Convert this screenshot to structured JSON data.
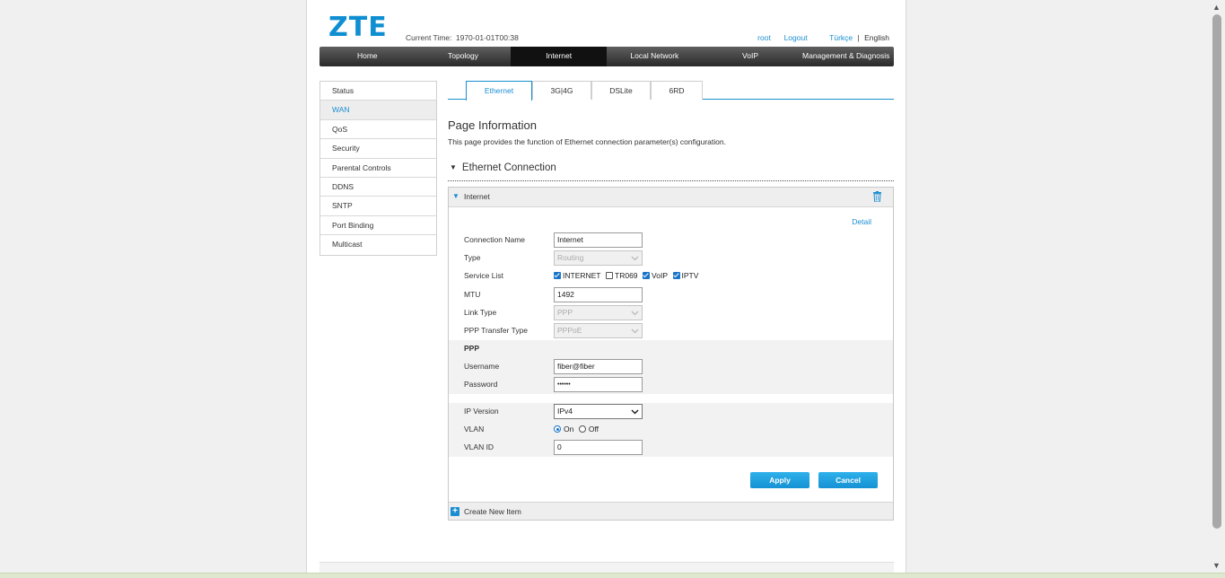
{
  "header": {
    "logo": "ZTE",
    "time_label": "Current Time:",
    "time_value": "1970-01-01T00:38",
    "user": "root",
    "logout": "Logout",
    "lang_tr": "Türkçe",
    "lang_sep": "|",
    "lang_en": "English"
  },
  "nav": {
    "items": [
      "Home",
      "Topology",
      "Internet",
      "Local Network",
      "VoIP",
      "Management & Diagnosis"
    ],
    "active": "Internet"
  },
  "sidebar": {
    "items": [
      "Status",
      "WAN",
      "QoS",
      "Security",
      "Parental Controls",
      "DDNS",
      "SNTP",
      "Port Binding",
      "Multicast"
    ],
    "active": "WAN"
  },
  "tabs": {
    "items": [
      "Ethernet",
      "3G|4G",
      "DSLite",
      "6RD"
    ],
    "active": "Ethernet"
  },
  "page_info": {
    "title": "Page Information",
    "description": "This page provides the function of Ethernet connection parameter(s) configuration."
  },
  "section": {
    "title": "Ethernet Connection"
  },
  "panel": {
    "name": "Internet",
    "detail": "Detail",
    "create_new": "Create New Item",
    "apply": "Apply",
    "cancel": "Cancel"
  },
  "form": {
    "connection_name": {
      "label": "Connection Name",
      "value": "Internet"
    },
    "type": {
      "label": "Type",
      "value": "Routing"
    },
    "service_list": {
      "label": "Service List",
      "options": [
        {
          "name": "INTERNET",
          "checked": true
        },
        {
          "name": "TR069",
          "checked": false
        },
        {
          "name": "VoIP",
          "checked": true
        },
        {
          "name": "IPTV",
          "checked": true
        }
      ]
    },
    "mtu": {
      "label": "MTU",
      "value": "1492"
    },
    "link_type": {
      "label": "Link Type",
      "value": "PPP"
    },
    "ppp_transfer_type": {
      "label": "PPP Transfer Type",
      "value": "PPPoE"
    },
    "ppp_heading": "PPP",
    "username": {
      "label": "Username",
      "value": "fiber@fiber"
    },
    "password": {
      "label": "Password",
      "value": "••••••"
    },
    "ip_version": {
      "label": "IP Version",
      "value": "IPv4"
    },
    "vlan": {
      "label": "VLAN",
      "on": "On",
      "off": "Off",
      "selected": "On"
    },
    "vlan_id": {
      "label": "VLAN ID",
      "value": "0"
    }
  },
  "colors": {
    "accent": "#1a8ed1",
    "nav_bg": "#2a2a2a",
    "button": "#1a9ad8"
  }
}
